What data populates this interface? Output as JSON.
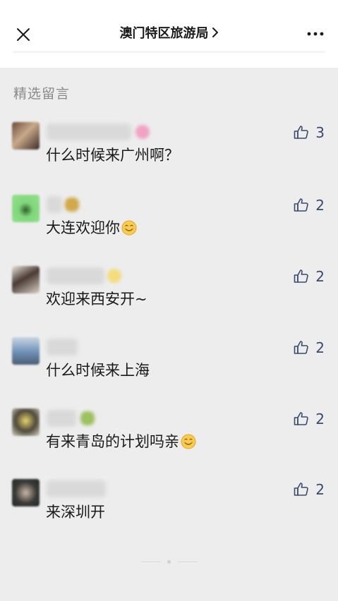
{
  "header": {
    "title": "澳门特区旅游局",
    "close_icon": "close-icon",
    "more_icon": "more-icon"
  },
  "section_title": "精选留言",
  "comments": [
    {
      "text": "什么时候来广州啊？",
      "likes": "3",
      "has_emoji": false
    },
    {
      "text": "大连欢迎你",
      "likes": "2",
      "has_emoji": true
    },
    {
      "text": "欢迎来西安开~",
      "likes": "2",
      "has_emoji": false
    },
    {
      "text": "什么时候来上海",
      "likes": "2",
      "has_emoji": false
    },
    {
      "text": "有来青岛的计划吗亲",
      "likes": "2",
      "has_emoji": true
    },
    {
      "text": "来深圳开",
      "likes": "2",
      "has_emoji": false
    }
  ],
  "colors": {
    "background": "#ededed",
    "like_count": "#3a4a6e",
    "text": "#1a1a1a",
    "section_title": "#8a8a8a"
  }
}
